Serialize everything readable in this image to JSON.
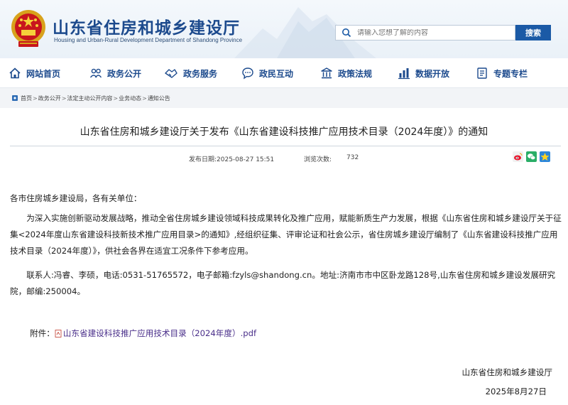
{
  "header": {
    "title": "山东省住房和城乡建设厅",
    "subtitle": "Housing and Urban-Rural Development Department of Shandong Province",
    "search_placeholder": "请输入您想了解的内容",
    "search_button": "搜索"
  },
  "nav": {
    "items": [
      {
        "label": "网站首页",
        "icon": "home-icon"
      },
      {
        "label": "政务公开",
        "icon": "people-icon"
      },
      {
        "label": "政务服务",
        "icon": "handshake-icon"
      },
      {
        "label": "政民互动",
        "icon": "chat-icon"
      },
      {
        "label": "政策法规",
        "icon": "building-icon"
      },
      {
        "label": "数据开放",
        "icon": "chart-icon"
      },
      {
        "label": "专题专栏",
        "icon": "topic-icon"
      }
    ]
  },
  "breadcrumb": [
    "首页",
    "政务公开",
    "法定主动公开内容",
    "业务动态",
    "通知公告"
  ],
  "article": {
    "title": "山东省住房和城乡建设厅关于发布《山东省建设科技推广应用技术目录（2024年度）》的通知",
    "date_label": "发布日期:2025-08-27 15:51",
    "views_label": "浏览次数:",
    "views": "732",
    "salutation": "各市住房城乡建设局，各有关单位：",
    "paragraph1": "为深入实施创新驱动发展战略，推动全省住房城乡建设领域科技成果转化及推广应用，赋能新质生产力发展，根据《山东省住房和城乡建设厅关于征集<2024年度山东省建设科技新技术推广应用目录>的通知》,经组织征集、评审论证和社会公示，省住房城乡建设厅编制了《山东省建设科技推广应用技术目录（2024年度）》，供社会各界在适宜工况条件下参考应用。",
    "paragraph2": "联系人:冯睿、李硕，电话:0531-51765572，电子邮箱:fzyls@shandong.cn。地址:济南市市中区卧龙路128号,山东省住房和城乡建设发展研究院，邮编:250004。",
    "attachment_label": "附件：",
    "attachment_link": "山东省建设科技推广应用技术目录（2024年度）.pdf",
    "signature_org": "山东省住房和城乡建设厅",
    "signature_date": "2025年8月27日"
  },
  "colors": {
    "brand_blue": "#1c4a8d",
    "search_button": "#1b5aa6",
    "link_purple": "#4a2f8a"
  }
}
